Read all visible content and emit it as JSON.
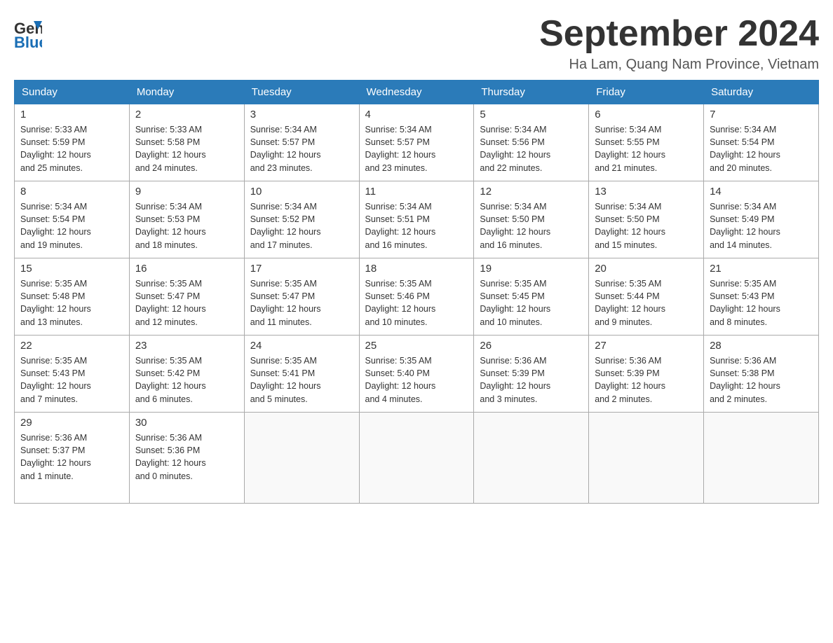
{
  "header": {
    "logo_general": "General",
    "logo_blue": "Blue",
    "month": "September 2024",
    "location": "Ha Lam, Quang Nam Province, Vietnam"
  },
  "days_of_week": [
    "Sunday",
    "Monday",
    "Tuesday",
    "Wednesday",
    "Thursday",
    "Friday",
    "Saturday"
  ],
  "weeks": [
    [
      {
        "day": "1",
        "sunrise": "5:33 AM",
        "sunset": "5:59 PM",
        "daylight": "12 hours and 25 minutes."
      },
      {
        "day": "2",
        "sunrise": "5:33 AM",
        "sunset": "5:58 PM",
        "daylight": "12 hours and 24 minutes."
      },
      {
        "day": "3",
        "sunrise": "5:34 AM",
        "sunset": "5:57 PM",
        "daylight": "12 hours and 23 minutes."
      },
      {
        "day": "4",
        "sunrise": "5:34 AM",
        "sunset": "5:57 PM",
        "daylight": "12 hours and 23 minutes."
      },
      {
        "day": "5",
        "sunrise": "5:34 AM",
        "sunset": "5:56 PM",
        "daylight": "12 hours and 22 minutes."
      },
      {
        "day": "6",
        "sunrise": "5:34 AM",
        "sunset": "5:55 PM",
        "daylight": "12 hours and 21 minutes."
      },
      {
        "day": "7",
        "sunrise": "5:34 AM",
        "sunset": "5:54 PM",
        "daylight": "12 hours and 20 minutes."
      }
    ],
    [
      {
        "day": "8",
        "sunrise": "5:34 AM",
        "sunset": "5:54 PM",
        "daylight": "12 hours and 19 minutes."
      },
      {
        "day": "9",
        "sunrise": "5:34 AM",
        "sunset": "5:53 PM",
        "daylight": "12 hours and 18 minutes."
      },
      {
        "day": "10",
        "sunrise": "5:34 AM",
        "sunset": "5:52 PM",
        "daylight": "12 hours and 17 minutes."
      },
      {
        "day": "11",
        "sunrise": "5:34 AM",
        "sunset": "5:51 PM",
        "daylight": "12 hours and 16 minutes."
      },
      {
        "day": "12",
        "sunrise": "5:34 AM",
        "sunset": "5:50 PM",
        "daylight": "12 hours and 16 minutes."
      },
      {
        "day": "13",
        "sunrise": "5:34 AM",
        "sunset": "5:50 PM",
        "daylight": "12 hours and 15 minutes."
      },
      {
        "day": "14",
        "sunrise": "5:34 AM",
        "sunset": "5:49 PM",
        "daylight": "12 hours and 14 minutes."
      }
    ],
    [
      {
        "day": "15",
        "sunrise": "5:35 AM",
        "sunset": "5:48 PM",
        "daylight": "12 hours and 13 minutes."
      },
      {
        "day": "16",
        "sunrise": "5:35 AM",
        "sunset": "5:47 PM",
        "daylight": "12 hours and 12 minutes."
      },
      {
        "day": "17",
        "sunrise": "5:35 AM",
        "sunset": "5:47 PM",
        "daylight": "12 hours and 11 minutes."
      },
      {
        "day": "18",
        "sunrise": "5:35 AM",
        "sunset": "5:46 PM",
        "daylight": "12 hours and 10 minutes."
      },
      {
        "day": "19",
        "sunrise": "5:35 AM",
        "sunset": "5:45 PM",
        "daylight": "12 hours and 10 minutes."
      },
      {
        "day": "20",
        "sunrise": "5:35 AM",
        "sunset": "5:44 PM",
        "daylight": "12 hours and 9 minutes."
      },
      {
        "day": "21",
        "sunrise": "5:35 AM",
        "sunset": "5:43 PM",
        "daylight": "12 hours and 8 minutes."
      }
    ],
    [
      {
        "day": "22",
        "sunrise": "5:35 AM",
        "sunset": "5:43 PM",
        "daylight": "12 hours and 7 minutes."
      },
      {
        "day": "23",
        "sunrise": "5:35 AM",
        "sunset": "5:42 PM",
        "daylight": "12 hours and 6 minutes."
      },
      {
        "day": "24",
        "sunrise": "5:35 AM",
        "sunset": "5:41 PM",
        "daylight": "12 hours and 5 minutes."
      },
      {
        "day": "25",
        "sunrise": "5:35 AM",
        "sunset": "5:40 PM",
        "daylight": "12 hours and 4 minutes."
      },
      {
        "day": "26",
        "sunrise": "5:36 AM",
        "sunset": "5:39 PM",
        "daylight": "12 hours and 3 minutes."
      },
      {
        "day": "27",
        "sunrise": "5:36 AM",
        "sunset": "5:39 PM",
        "daylight": "12 hours and 2 minutes."
      },
      {
        "day": "28",
        "sunrise": "5:36 AM",
        "sunset": "5:38 PM",
        "daylight": "12 hours and 2 minutes."
      }
    ],
    [
      {
        "day": "29",
        "sunrise": "5:36 AM",
        "sunset": "5:37 PM",
        "daylight": "12 hours and 1 minute."
      },
      {
        "day": "30",
        "sunrise": "5:36 AM",
        "sunset": "5:36 PM",
        "daylight": "12 hours and 0 minutes."
      },
      null,
      null,
      null,
      null,
      null
    ]
  ],
  "labels": {
    "sunrise": "Sunrise:",
    "sunset": "Sunset:",
    "daylight": "Daylight:"
  }
}
